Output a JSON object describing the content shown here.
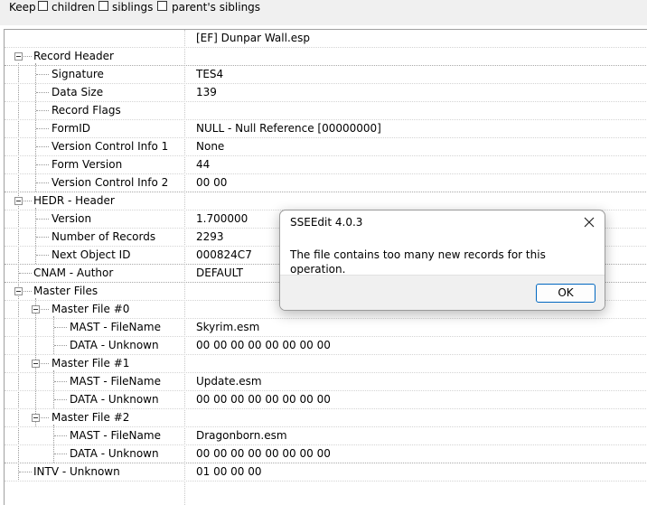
{
  "keep_bar": {
    "keep_label": "Keep",
    "children_label": "children",
    "siblings_label": "siblings",
    "parents_siblings_label": "parent's siblings"
  },
  "grid": {
    "file_name": "[EF] Dunpar Wall.esp",
    "record_header": "Record Header",
    "signature_label": "Signature",
    "signature_value": "TES4",
    "data_size_label": "Data Size",
    "data_size_value": "139",
    "record_flags_label": "Record Flags",
    "formid_label": "FormID",
    "formid_value": "NULL - Null Reference [00000000]",
    "vci1_label": "Version Control Info 1",
    "vci1_value": "None",
    "form_version_label": "Form Version",
    "form_version_value": "44",
    "vci2_label": "Version Control Info 2",
    "vci2_value": "00 00",
    "hedr_label": "HEDR - Header",
    "version_label": "Version",
    "version_value": "1.700000",
    "num_records_label": "Number of Records",
    "num_records_value": "2293",
    "next_object_label": "Next Object ID",
    "next_object_value": "000824C7",
    "cnam_label": "CNAM - Author",
    "cnam_value": "DEFAULT",
    "master_files_label": "Master Files",
    "master0_label": "Master File #0",
    "master0_mast_label": "MAST - FileName",
    "master0_mast_value": "Skyrim.esm",
    "master0_data_label": "DATA - Unknown",
    "master0_data_value": "00 00 00 00 00 00 00 00",
    "master1_label": "Master File #1",
    "master1_mast_label": "MAST - FileName",
    "master1_mast_value": "Update.esm",
    "master1_data_label": "DATA - Unknown",
    "master1_data_value": "00 00 00 00 00 00 00 00",
    "master2_label": "Master File #2",
    "master2_mast_label": "MAST - FileName",
    "master2_mast_value": "Dragonborn.esm",
    "master2_data_label": "DATA - Unknown",
    "master2_data_value": "00 00 00 00 00 00 00 00",
    "intv_label": "INTV - Unknown",
    "intv_value": "01 00 00 00"
  },
  "dialog": {
    "title": "SSEEdit 4.0.3",
    "message": "The file contains too many new records for this operation.",
    "ok_label": "OK",
    "close_icon": "close-icon"
  },
  "colors": {
    "button_border": "#0067c0",
    "footer_bg": "#f0f0f0",
    "toolbar_bg": "#f0f0f0"
  }
}
